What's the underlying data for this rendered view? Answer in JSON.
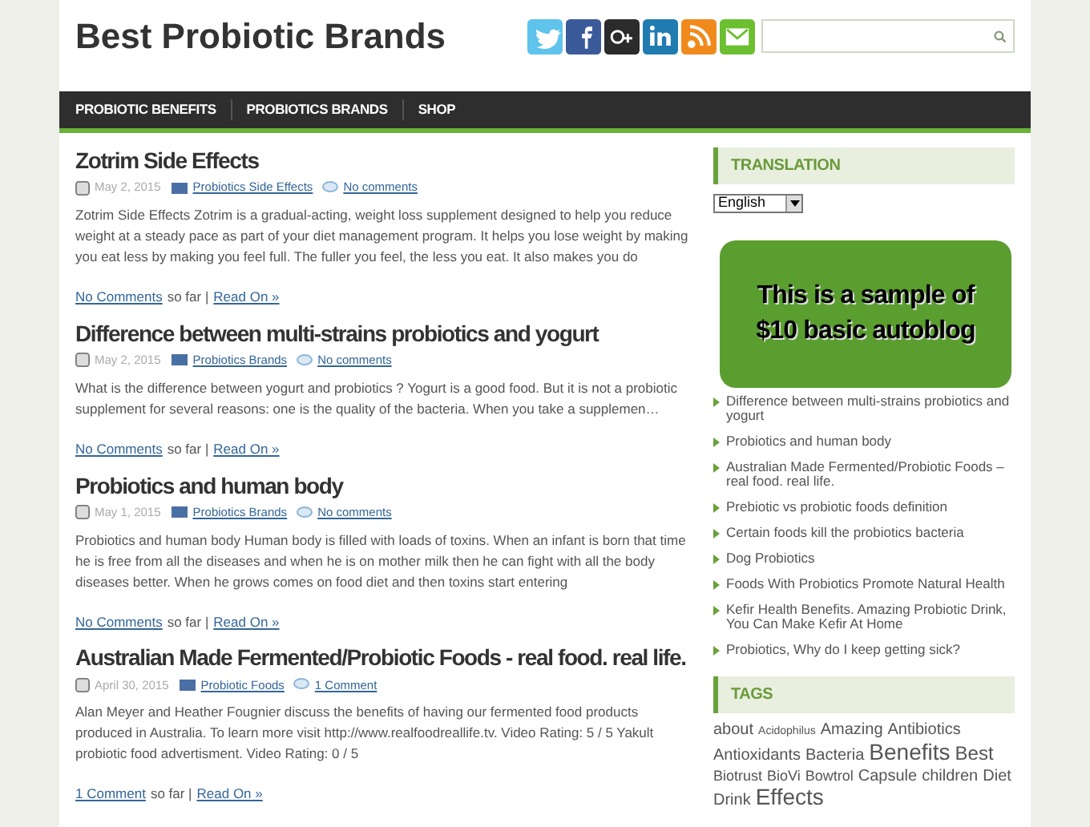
{
  "site_title": "Best Probiotic Brands",
  "social": [
    {
      "kind": "twitter"
    },
    {
      "kind": "facebook"
    },
    {
      "kind": "googleplus"
    },
    {
      "kind": "linkedin"
    },
    {
      "kind": "rss"
    },
    {
      "kind": "email"
    }
  ],
  "nav": [
    "PROBIOTIC BENEFITS",
    "PROBIOTICS BRANDS",
    "SHOP"
  ],
  "posts": [
    {
      "title": "Zotrim Side Effects",
      "date": "May 2, 2015",
      "category": "Probiotics Side Effects",
      "comments": "No comments",
      "excerpt": "Zotrim Side Effects Zotrim is a gradual-acting, weight loss supplement designed to help you reduce weight at a steady pace as part of your diet management program. It helps you lose weight by making you eat less by making you feel full. The fuller you feel, the less you eat. It also makes you do",
      "footer_comments": "No Comments",
      "footer_text": "so far |",
      "read_on": "Read On »"
    },
    {
      "title": "Difference between multi-strains probiotics and yogurt",
      "date": "May 2, 2015",
      "category": "Probiotics Brands",
      "comments": "No comments",
      "excerpt": "What is the difference between yogurt and probiotics ? Yogurt is a good food. But it is not a probiotic supplement for several reasons: one is the quality of the bacteria. When you take a supplemen…",
      "footer_comments": "No Comments",
      "footer_text": "so far |",
      "read_on": "Read On »"
    },
    {
      "title": "Probiotics and human body",
      "date": "May 1, 2015",
      "category": "Probiotics Brands",
      "comments": "No comments",
      "excerpt": "Probiotics and human body Human body is filled with loads of toxins. When an infant is born that time he is free from all the diseases and when he is on mother milk then he can fight with all the body diseases better. When he grows comes on food diet and then toxins start entering",
      "footer_comments": "No Comments",
      "footer_text": "so far |",
      "read_on": "Read On »"
    },
    {
      "title": "Australian Made Fermented/Probiotic Foods - real food. real life.",
      "date": "April 30, 2015",
      "category": "Probiotic Foods",
      "comments": "1 Comment",
      "excerpt": "Alan Meyer and Heather Fougnier discuss the benefits of having our fermented food products produced in Australia. To learn more visit http://www.realfoodreallife.tv. Video Rating: 5 / 5 Yakult probiotic food advertisment. Video Rating: 0 / 5",
      "footer_comments": "1 Comment",
      "footer_text": "so far |",
      "read_on": "Read On »"
    }
  ],
  "sidebar": {
    "translation_heading": "TRANSLATION",
    "language_select": "English",
    "overlay": "This is a sample of $10 basic autoblog",
    "recent_posts": [
      "Difference between multi-strains probiotics and yogurt",
      "Probiotics and human body",
      "Australian Made Fermented/Probiotic Foods – real food. real life.",
      "Prebiotic vs probiotic foods definition",
      "Certain foods kill the probiotics bacteria",
      "Dog Probiotics",
      "Foods With Probiotics Promote Natural Health",
      "Kefir Health Benefits. Amazing Probiotic Drink, You Can Make Kefir At Home",
      "Probiotics, Why do I keep getting sick?"
    ],
    "tags_heading": "TAGS",
    "tags": [
      {
        "label": "about",
        "kind": "medium"
      },
      {
        "label": "Acidophilus",
        "kind": "tiny"
      },
      {
        "label": "Amazing",
        "kind": "medium"
      },
      {
        "label": "Antibiotics",
        "kind": "medium"
      },
      {
        "label": "Antioxidants",
        "kind": "medium"
      },
      {
        "label": "Bacteria",
        "kind": "medium"
      },
      {
        "label": "Benefits",
        "kind": "huge"
      },
      {
        "label": "Best",
        "kind": "large"
      },
      {
        "label": "Biotrust",
        "kind": "small"
      },
      {
        "label": "BioVi",
        "kind": "small"
      },
      {
        "label": "Bowtrol",
        "kind": "small"
      },
      {
        "label": "Capsule",
        "kind": "medium"
      },
      {
        "label": "children",
        "kind": "medium"
      },
      {
        "label": "Diet",
        "kind": "medium"
      },
      {
        "label": "Drink",
        "kind": "medium"
      },
      {
        "label": "Effects",
        "kind": "huge"
      }
    ]
  }
}
